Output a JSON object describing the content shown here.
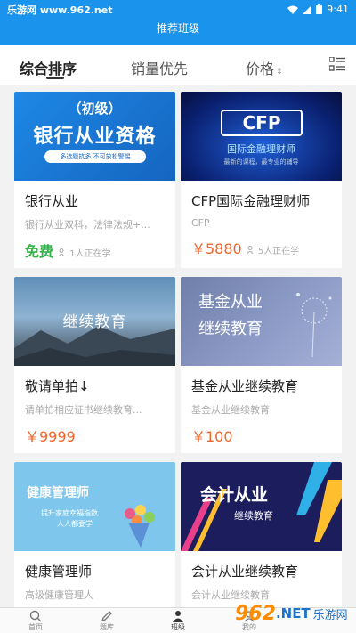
{
  "status_bar": {
    "watermark": "乐游网 www.962.net",
    "time": "9:41"
  },
  "appbar": {
    "title": "推荐班级"
  },
  "tabs": [
    {
      "label": "综合排序"
    },
    {
      "label": "销量优先"
    },
    {
      "label": "价格",
      "sort_symbol": "⇕"
    }
  ],
  "cards": [
    {
      "banner": [
        "（初级）",
        "银行从业资格",
        "多选题抗多 不可放松警惕"
      ],
      "title": "银行从业",
      "subtitle": "银行从业双科，法律法规+...",
      "price": "免费",
      "enrolled": "1人正在学"
    },
    {
      "banner": [
        "CFP",
        "国际金融理财师",
        "最新的课程，最专业的辅导"
      ],
      "title": "CFP国际金融理财师",
      "subtitle": "CFP",
      "price": "￥5880",
      "enrolled": "5人正在学"
    },
    {
      "banner": [
        "继续教育"
      ],
      "title": "敬请单拍↓",
      "subtitle": "请单拍相应证书继续教育...",
      "price": "￥9999",
      "enrolled": ""
    },
    {
      "banner": [
        "基金从业",
        "继续教育"
      ],
      "title": "基金从业继续教育",
      "subtitle": "基金从业继续教育",
      "price": "￥100",
      "enrolled": ""
    },
    {
      "banner": [
        "健康管理师",
        "提升家庭幸福指数",
        "人人都要学"
      ],
      "title": "健康管理师",
      "subtitle": "高级健康管理人",
      "price": "",
      "enrolled": ""
    },
    {
      "banner": [
        "会计从业",
        "继续教育"
      ],
      "title": "会计从业继续教育",
      "subtitle": "会计从业继续教育",
      "price": "",
      "enrolled": ""
    }
  ],
  "bottom_nav": [
    {
      "label": "首页",
      "icon": "search-icon"
    },
    {
      "label": "题库",
      "icon": "pencil-icon"
    },
    {
      "label": "班级",
      "icon": "person-icon"
    },
    {
      "label": "我的",
      "icon": "user-icon"
    }
  ],
  "watermark_br": {
    "num": "962",
    "suffix": ".NET",
    "cn": "乐游网"
  },
  "colors": {
    "primary": "#1a93ec",
    "price": "#f0652a",
    "free": "#33b24a"
  }
}
